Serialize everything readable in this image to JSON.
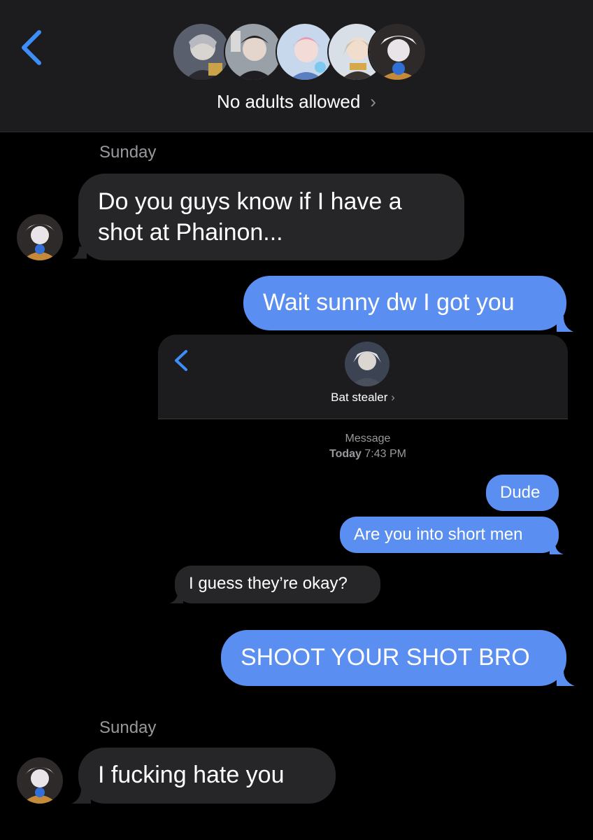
{
  "header": {
    "group_name": "No adults allowed",
    "chevron": "›",
    "back_icon": "chevron-left-icon",
    "accent": "#3e8ef7"
  },
  "thread": {
    "day1": "Sunday",
    "msg1": "Do you guys know if I have a shot at Phainon...",
    "msg1_line1": "Do you guys know if I have a",
    "msg1_line2": "shot at Phainon...",
    "msg2": "Wait sunny dw I got you",
    "embedded": {
      "contact_name": "Bat stealer",
      "chevron": "›",
      "meta_label": "Message",
      "meta_day": "Today",
      "meta_time": "7:43 PM",
      "messages": [
        {
          "text": "Dude",
          "from": "me"
        },
        {
          "text": "Are you into short men",
          "from": "me"
        },
        {
          "text": "I guess they’re okay?",
          "from": "them"
        }
      ]
    },
    "msg3": "SHOOT YOUR SHOT BRO",
    "day2": "Sunday",
    "msg4": "I fucking hate you"
  },
  "colors": {
    "sent_bubble": "#5a8ef0",
    "received_bubble": "#262628",
    "background": "#000000",
    "header_bg": "#1c1c1e"
  }
}
